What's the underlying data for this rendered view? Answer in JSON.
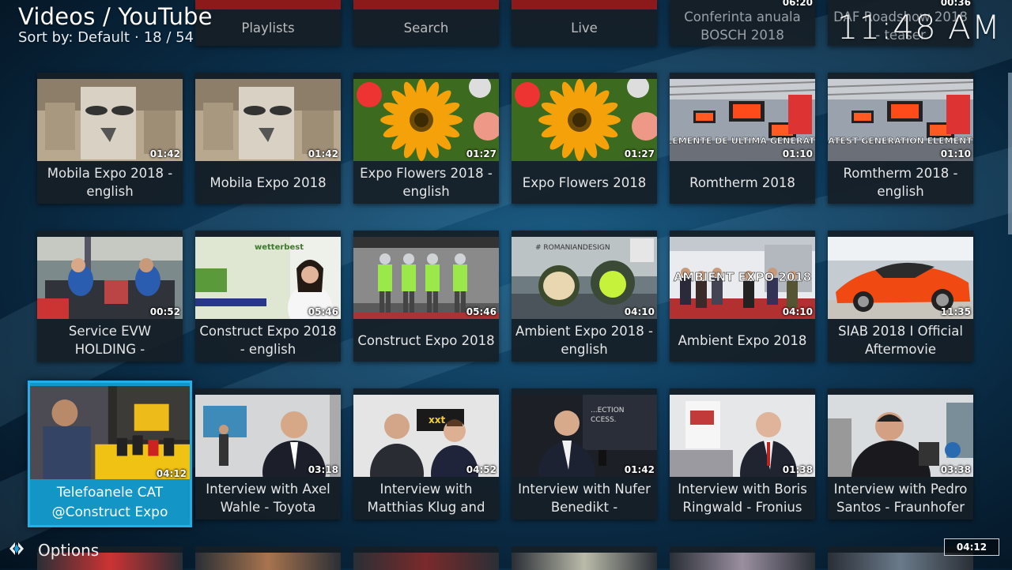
{
  "header": {
    "title": "Videos / YouTube",
    "sort_label": "Sort by: Default",
    "dot": "·",
    "position": "18 / 54",
    "clock": "11:48 AM"
  },
  "top_row": [
    {
      "label": "Playlists"
    },
    {
      "label": "Search"
    },
    {
      "label": "Live"
    },
    {
      "label": "Conferinta anuala BOSCH 2018",
      "duration": "06:20"
    },
    {
      "label": "DAF Roadshow 2018 - teaser",
      "duration": "00:36"
    }
  ],
  "rows": [
    [
      {
        "label": "Mobila Expo 2018 - english",
        "duration": "01:42",
        "thumb": "mobila"
      },
      {
        "label": "Mobila Expo 2018",
        "duration": "01:42",
        "thumb": "mobila"
      },
      {
        "label": "Expo Flowers 2018 - english",
        "duration": "01:27",
        "thumb": "flower"
      },
      {
        "label": "Expo Flowers 2018",
        "duration": "01:27",
        "thumb": "flower"
      },
      {
        "label": "Romtherm 2018",
        "duration": "01:10",
        "thumb": "heater",
        "overlay": "ELEMENTE DE ULTIMA GENERATIE"
      },
      {
        "label": "Romtherm 2018 - english",
        "duration": "01:10",
        "thumb": "heater",
        "overlay": "LATEST GENERATION ELEMENTS"
      }
    ],
    [
      {
        "label": "Service EVW HOLDING -",
        "duration": "00:52",
        "thumb": "workshop"
      },
      {
        "label": "Construct Expo 2018 - english",
        "duration": "05:46",
        "thumb": "woman"
      },
      {
        "label": "Construct Expo 2018",
        "duration": "05:46",
        "thumb": "mannequins"
      },
      {
        "label": "Ambient Expo 2018 - english",
        "duration": "04:10",
        "thumb": "lamps",
        "overlay": "# ROMANIANDESIGN"
      },
      {
        "label": "Ambient Expo 2018",
        "duration": "04:10",
        "thumb": "crowd",
        "overlay": "AMBIENT EXPO 2018"
      },
      {
        "label": "SIAB 2018 I Official Aftermovie",
        "duration": "11:35",
        "thumb": "car"
      }
    ],
    [
      {
        "label": "Telefoanele CAT @Construct Expo",
        "duration": "04:12",
        "thumb": "phones",
        "focused": true
      },
      {
        "label": "Interview with Axel Wahle - Toyota",
        "duration": "03:18",
        "thumb": "interview1"
      },
      {
        "label": "Interview with Matthias Klug and",
        "duration": "04:52",
        "thumb": "interview2"
      },
      {
        "label": "Interview with Nufer Benedikt -",
        "duration": "01:42",
        "thumb": "interview3"
      },
      {
        "label": "Interview with Boris Ringwald - Fronius",
        "duration": "01:38",
        "thumb": "interview4"
      },
      {
        "label": "Interview with Pedro Santos - Fraunhofer",
        "duration": "03:38",
        "thumb": "interview5"
      }
    ]
  ],
  "footer": {
    "options_label": "Options",
    "playing_time": "04:12"
  }
}
